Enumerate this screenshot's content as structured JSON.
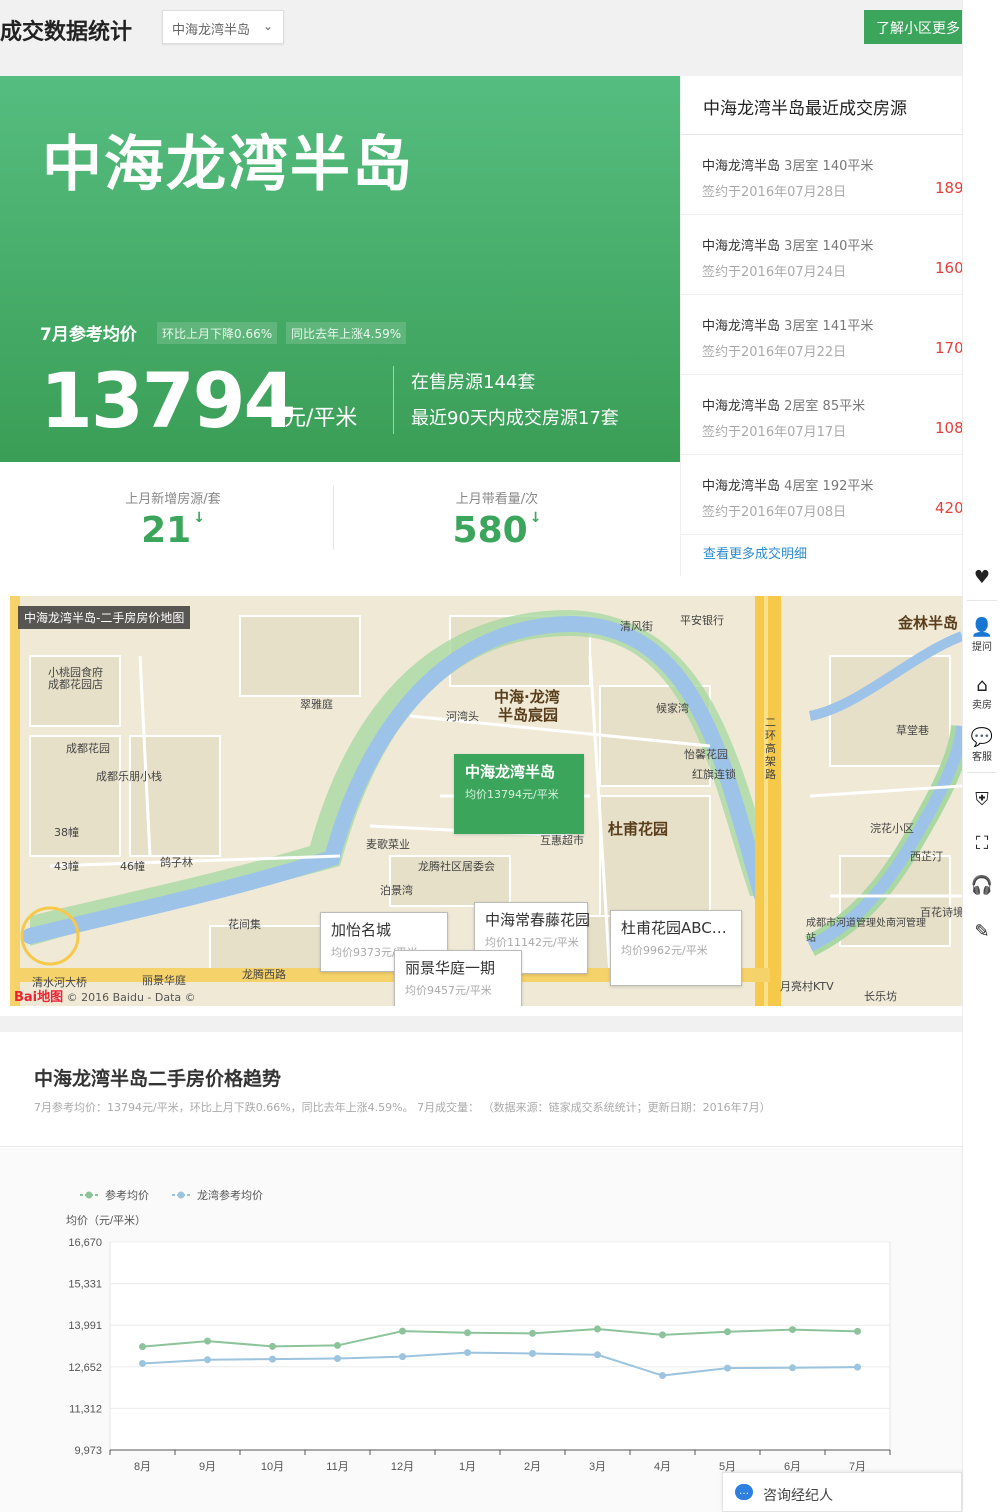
{
  "header": {
    "title": "成交数据统计",
    "community_select": "中海龙湾半岛",
    "more_button": "了解小区更多"
  },
  "hero": {
    "name": "中海龙湾半岛",
    "price_label": "7月参考均价",
    "tag_mom": "环比上月下降0.66%",
    "tag_yoy": "同比去年上涨4.59%",
    "price": "13794",
    "unit": "元/平米",
    "onsale": "在售房源144套",
    "deal90": "最近90天内成交房源17套"
  },
  "stats": [
    {
      "label": "上月新增房源/套",
      "value": "21",
      "arrow": "↓"
    },
    {
      "label": "上月带看量/次",
      "value": "580",
      "arrow": "↓"
    }
  ],
  "deals": {
    "title": "中海龙湾半岛最近成交房源",
    "items": [
      {
        "name": "中海龙湾半岛",
        "spec": "3居室 140平米",
        "date": "签约于2016年07月28日",
        "price": "189"
      },
      {
        "name": "中海龙湾半岛",
        "spec": "3居室 140平米",
        "date": "签约于2016年07月24日",
        "price": "160"
      },
      {
        "name": "中海龙湾半岛",
        "spec": "3居室 141平米",
        "date": "签约于2016年07月22日",
        "price": "170"
      },
      {
        "name": "中海龙湾半岛",
        "spec": "2居室 85平米",
        "date": "签约于2016年07月17日",
        "price": "108"
      },
      {
        "name": "中海龙湾半岛",
        "spec": "4居室 192平米",
        "date": "签约于2016年07月08日",
        "price": "420"
      }
    ],
    "more": "查看更多成交明细"
  },
  "map": {
    "title": "中海龙湾半岛-二手房房价地图",
    "copyright": "© 2016 Baidu - Data ©",
    "baidu_logo": "Bai地图",
    "labels": [
      {
        "text": "中海·龙湾",
        "kind": "big"
      },
      {
        "text": "半岛宸园",
        "kind": "big"
      },
      {
        "text": "杜甫花园",
        "kind": "big"
      },
      {
        "text": "金林半岛",
        "kind": "big"
      },
      {
        "text": "清风街",
        "kind": "small"
      },
      {
        "text": "平安银行",
        "kind": "small"
      },
      {
        "text": "翠雅庭",
        "kind": "small"
      },
      {
        "text": "小桃园食府",
        "kind": "small"
      },
      {
        "text": "成都花园店",
        "kind": "small"
      },
      {
        "text": "成都花园",
        "kind": "small"
      },
      {
        "text": "成都乐朋小栈",
        "kind": "small"
      },
      {
        "text": "38幢",
        "kind": "small"
      },
      {
        "text": "43幢",
        "kind": "small"
      },
      {
        "text": "46幢",
        "kind": "small"
      },
      {
        "text": "鸽子林",
        "kind": "small"
      },
      {
        "text": "河湾头",
        "kind": "small"
      },
      {
        "text": "候家湾",
        "kind": "small"
      },
      {
        "text": "怡馨花园",
        "kind": "small"
      },
      {
        "text": "红旗连锁",
        "kind": "small"
      },
      {
        "text": "麦歌菜业",
        "kind": "small"
      },
      {
        "text": "互惠超市",
        "kind": "small"
      },
      {
        "text": "龙腾社区居委会",
        "kind": "small"
      },
      {
        "text": "泊景湾",
        "kind": "small"
      },
      {
        "text": "花间集",
        "kind": "small"
      },
      {
        "text": "龙腾西路",
        "kind": "small"
      },
      {
        "text": "清水河大桥",
        "kind": "small"
      },
      {
        "text": "丽景华庭",
        "kind": "small"
      },
      {
        "text": "浣花小区",
        "kind": "small"
      },
      {
        "text": "西芷汀",
        "kind": "small"
      },
      {
        "text": "百花诗境",
        "kind": "small"
      },
      {
        "text": "成都市河道管理处南河管理站",
        "kind": "small"
      },
      {
        "text": "月亮村KTV",
        "kind": "small"
      },
      {
        "text": "长乐坊",
        "kind": "small"
      },
      {
        "text": "二环高架路",
        "kind": "small"
      },
      {
        "text": "草堂巷",
        "kind": "small"
      }
    ],
    "bubbles": [
      {
        "name": "中海龙湾半岛",
        "price": "均价13794元/平米",
        "main": true
      },
      {
        "name": "加怡名城",
        "price": "均价9373元/平米",
        "main": false
      },
      {
        "name": "中海常春藤花园",
        "price": "均价11142元/平米",
        "main": false
      },
      {
        "name": "丽景华庭一期",
        "price": "均价9457元/平米",
        "main": false
      },
      {
        "name": "杜甫花园ABC…",
        "price": "均价9962元/平米",
        "main": false
      }
    ]
  },
  "trend": {
    "title": "中海龙湾半岛二手房价格趋势",
    "subtitle": "7月参考均价：13794元/平米，环比上月下跌0.66%，同比去年上涨4.59%。 7月成交量： （数据来源：链家成交系统统计；更新日期：2016年7月）"
  },
  "chart_data": {
    "type": "line",
    "title": "",
    "ylabel": "均价（元/平米）",
    "xlabel": "",
    "categories": [
      "8月",
      "9月",
      "10月",
      "11月",
      "12月",
      "1月",
      "2月",
      "3月",
      "4月",
      "5月",
      "6月",
      "7月"
    ],
    "ylim": [
      9973,
      16670
    ],
    "yticks": [
      "16,670",
      "15,331",
      "13,991",
      "12,652",
      "11,312",
      "9,973"
    ],
    "ytick_values": [
      16670,
      15331,
      13991,
      12652,
      11312,
      9973
    ],
    "grid": true,
    "legend_position": "top-left",
    "series": [
      {
        "name": "参考均价",
        "color": "#8dc39a",
        "values": [
          13300,
          13480,
          13310,
          13340,
          13800,
          13750,
          13730,
          13870,
          13680,
          13780,
          13850,
          13794
        ]
      },
      {
        "name": "龙湾参考均价",
        "color": "#9cc4de",
        "values": [
          12760,
          12880,
          12900,
          12920,
          12980,
          13110,
          13080,
          13040,
          12370,
          12610,
          12620,
          12640
        ]
      }
    ]
  },
  "rail": [
    {
      "icon": "heart-icon",
      "glyph": "♥",
      "label": ""
    },
    {
      "icon": "ask-icon",
      "glyph": "👤",
      "label": "提问"
    },
    {
      "icon": "sell-house-icon",
      "glyph": "⌂",
      "label": "卖房"
    },
    {
      "icon": "service-icon",
      "glyph": "💬",
      "label": "客服"
    },
    {
      "icon": "shield-icon",
      "glyph": "⛨",
      "label": ""
    },
    {
      "icon": "scan-icon",
      "glyph": "⛶",
      "label": ""
    },
    {
      "icon": "headset-icon",
      "glyph": "🎧",
      "label": ""
    },
    {
      "icon": "edit-icon",
      "glyph": "✎",
      "label": ""
    }
  ],
  "consult": {
    "label": "咨询经纪人"
  },
  "colors": {
    "brand_green": "#3ca55c",
    "price_red": "#e2403a",
    "link_blue": "#2d8ccf"
  }
}
